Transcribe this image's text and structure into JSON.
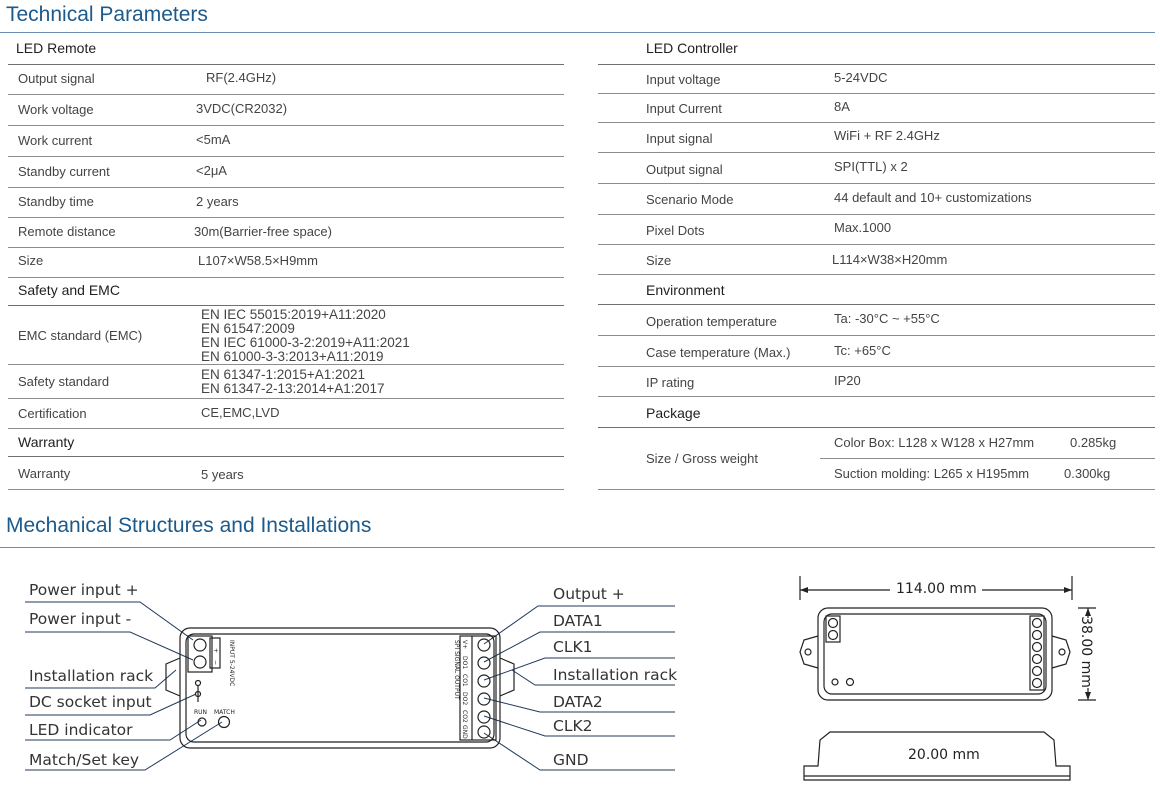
{
  "tech_title": "Technical Parameters",
  "mech_title": "Mechanical Structures and Installations",
  "remote": {
    "heading": "LED Remote",
    "rows": [
      {
        "label": "Output  signal",
        "value": "RF(2.4GHz)"
      },
      {
        "label": "Work  voltage",
        "value": "3VDC(CR2032)"
      },
      {
        "label": "Work  current",
        "value": "<5mA"
      },
      {
        "label": "Standby current",
        "value": "<2μA"
      },
      {
        "label": "Standby time",
        "value": "2 years"
      },
      {
        "label": "Remote distance",
        "value": "30m(Barrier-free space)"
      },
      {
        "label": "Size",
        "value": "L107×W58.5×H9mm"
      }
    ]
  },
  "safety": {
    "heading": "Safety and EMC",
    "emc_label": "EMC standard (EMC)",
    "emc_lines": [
      "EN IEC 55015:2019+A11:2020",
      "EN 61547:2009",
      "EN IEC 61000-3-2:2019+A11:2021",
      "EN 61000-3-3:2013+A11:2019"
    ],
    "safety_label": "Safety standard",
    "safety_lines": [
      "EN 61347-1:2015+A1:2021",
      "EN 61347-2-13:2014+A1:2017"
    ],
    "cert_label": "Certification",
    "cert_value": "CE,EMC,LVD"
  },
  "warranty": {
    "heading": "Warranty",
    "label": "Warranty",
    "value": "5 years"
  },
  "controller": {
    "heading": "LED Controller",
    "rows": [
      {
        "label": "Input voltage",
        "value": "5-24VDC"
      },
      {
        "label": "Input Current",
        "value": "8A"
      },
      {
        "label": "Input  signal",
        "value": "WiFi + RF 2.4GHz"
      },
      {
        "label": "Output signal",
        "value": "SPI(TTL) x 2"
      },
      {
        "label": "Scenario Mode",
        "value": "44 default and 10+ customizations"
      },
      {
        "label": "Pixel Dots",
        "value": "Max.1000"
      },
      {
        "label": "Size",
        "value": "L114×W38×H20mm"
      }
    ]
  },
  "environment": {
    "heading": "Environment",
    "rows": [
      {
        "label": "Operation temperature",
        "value": "Ta: -30°C ~ +55°C"
      },
      {
        "label": "Case temperature (Max.)",
        "value": "Tc: +65°C"
      },
      {
        "label": "IP rating",
        "value": "IP20"
      }
    ]
  },
  "package": {
    "heading": "Package",
    "label": "Size  /  Gross weight",
    "rows": [
      {
        "desc": "Color Box: L128 x W128 x H27mm",
        "weight": "0.285kg"
      },
      {
        "desc": "Suction molding: L265 x H195mm",
        "weight": "0.300kg"
      }
    ]
  },
  "diagram": {
    "left_labels": [
      "Power input +",
      "Power input -",
      "Installation rack",
      "DC socket input",
      "LED indicator",
      "Match/Set key"
    ],
    "right_labels": [
      "Output +",
      "DATA1",
      "CLK1",
      "Installation rack",
      "DATA2",
      "CLK2",
      "GND"
    ],
    "input_text": "INPUT 5-24VDC",
    "run_text": "RUN",
    "match_text": "MATCH",
    "spi_text": "SPI SIGNAL OUTPUT",
    "pin_labels": [
      "V+",
      "DO1",
      "CO1",
      "DO2",
      "CO2",
      "GND"
    ],
    "dim_width": "114.00 mm",
    "dim_height": "38.00 mm",
    "dim_depth": "20.00 mm"
  }
}
